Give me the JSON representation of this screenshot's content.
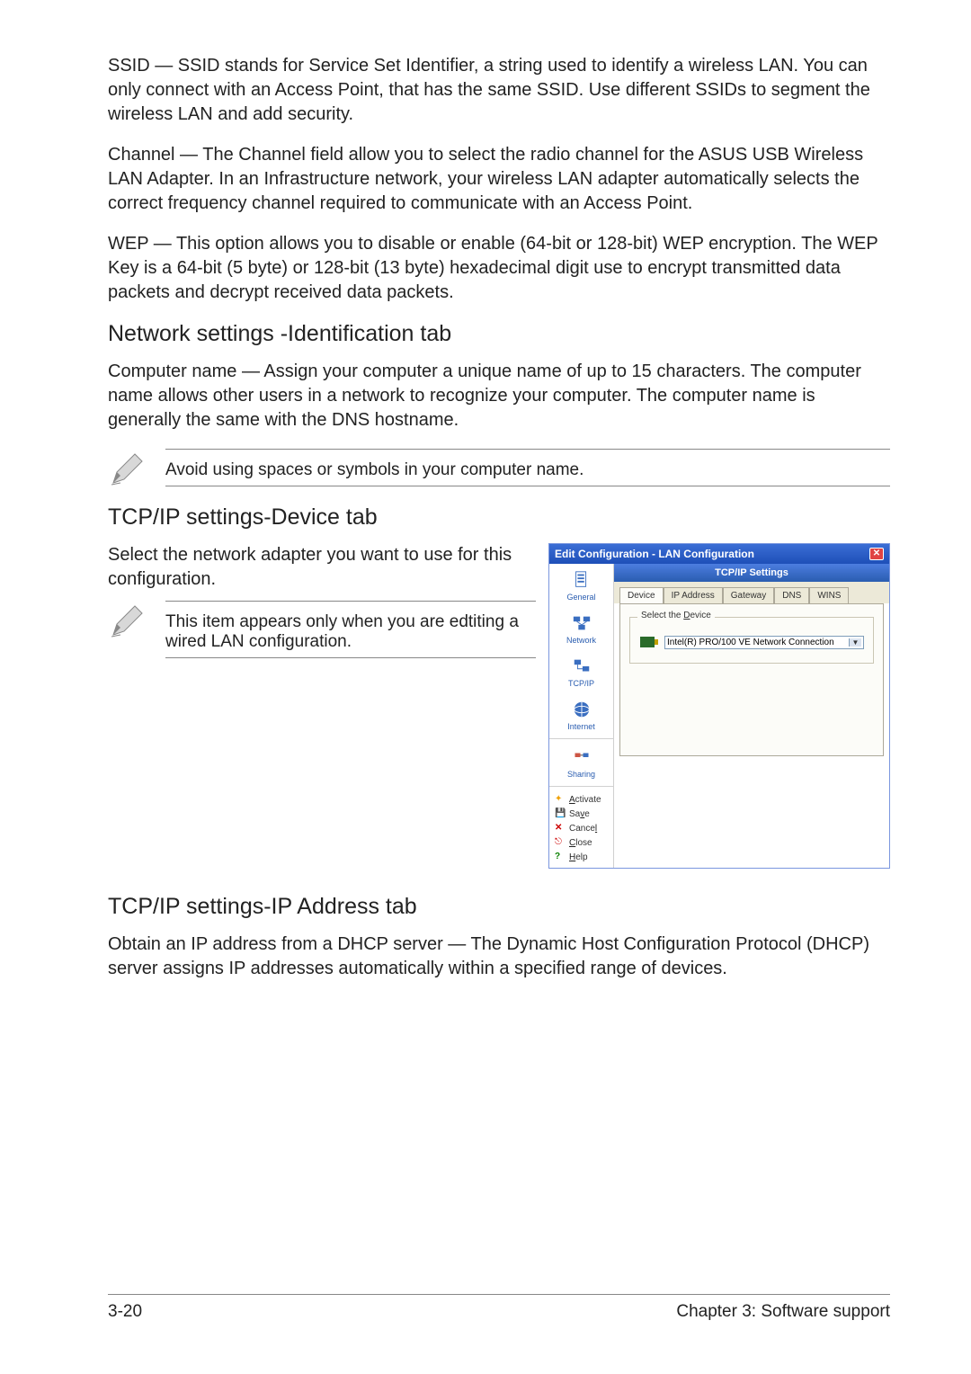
{
  "para_ssid": "SSID — SSID stands for Service Set Identifier, a string used to identify a wireless LAN. You can only connect with an Access Point, that has the same SSID. Use different SSIDs to segment the wireless LAN and add security.",
  "ssid_label": "SSID",
  "para_channel": "Channel  — The Channel field allow you to select the radio channel for the ASUS USB Wireless LAN Adapter. In an Infrastructure network, your wireless LAN adapter automatically selects the correct frequency channel required to communicate with an Access Point.",
  "channel_label": "Channel",
  "para_wep": "WEP — This option allows you to disable or enable (64-bit or 128-bit) WEP encryption. The WEP Key is a 64-bit (5 byte) or 128-bit (13 byte) hexadecimal digit use to encrypt transmitted data packets and decrypt received data packets.",
  "wep_label": "WEP",
  "heading_network_id": "Network settings -Identification tab",
  "para_compname": "Computer name   — Assign your computer a unique name of up to 15 characters. The computer name allows other users in a network to recognize your computer. The computer name is generally the same with the DNS hostname.",
  "compname_label": "Computer name",
  "note1": "Avoid using spaces or symbols in your computer name.",
  "heading_tcp_device": "TCP/IP settings-Device tab",
  "para_select_adapter": "Select the network adapter you want to use for this configuration.",
  "note2": "This item appears only when you are edtiting a wired LAN configuration.",
  "dialog": {
    "title": "Edit Configuration - LAN Configuration",
    "panel_header": "TCP/IP Settings",
    "tabs": [
      "Device",
      "IP Address",
      "Gateway",
      "DNS",
      "WINS"
    ],
    "fieldset_legend": "Select the Device",
    "device_selected": "Intel(R) PRO/100 VE Network Connection",
    "sidebar": {
      "general": "General",
      "network": "Network",
      "tcpip": "TCP/IP",
      "internet": "Internet",
      "sharing": "Sharing"
    },
    "actions": {
      "activate": "Activate",
      "save": "Save",
      "cancel": "Cancel",
      "close": "Close",
      "help": "Help"
    }
  },
  "heading_tcp_ip": "TCP/IP settings-IP Address tab",
  "para_dhcp": "Obtain an IP address from a DHCP server    — The Dynamic Host Configuration Protocol (DHCP) server assigns IP addresses automatically within a specified range of devices.",
  "dhcp_label": "Obtain an IP address from a DHCP server",
  "footer": {
    "page": "3-20",
    "chapter": "Chapter 3: Software support"
  }
}
